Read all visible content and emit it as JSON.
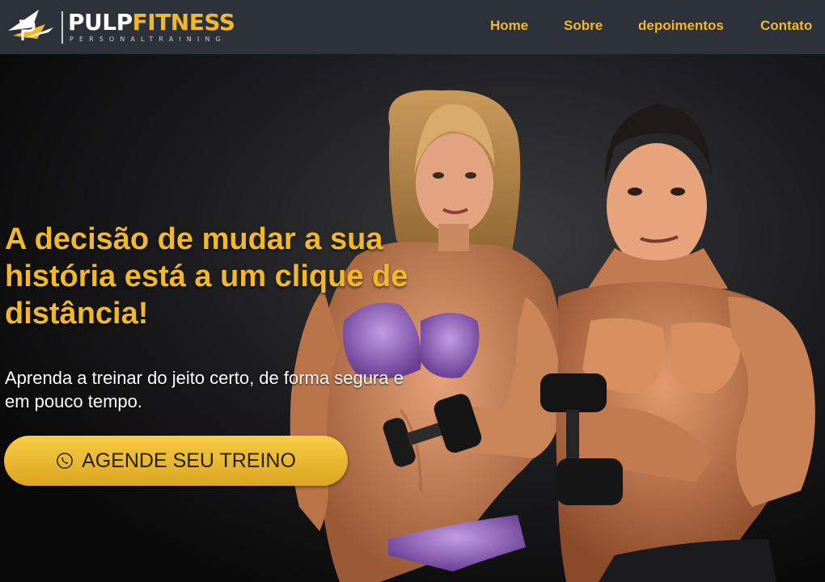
{
  "header": {
    "brand_part1": "PULP",
    "brand_part2": "FITNESS",
    "brand_tagline": "PERSONALTRAINING",
    "logo_icon": "pf-logo-mark"
  },
  "nav": {
    "items": [
      {
        "label": "Home"
      },
      {
        "label": "Sobre"
      },
      {
        "label": "depoimentos"
      },
      {
        "label": "Contato"
      }
    ]
  },
  "hero": {
    "headline": "A decisão de mudar a sua história está a um clique de distância!",
    "subtext": "Aprenda a treinar do jeito certo, de forma segura e em pouco tempo.",
    "cta_label": "AGENDE SEU TREINO",
    "cta_icon": "phone-icon",
    "photo": "fitness-couple-with-dumbbells"
  },
  "colors": {
    "accent": "#f1b82a",
    "header_bg": "#2c313a",
    "hero_bg": "#0b0b0c",
    "cta_gradient_top": "#f8cd45",
    "cta_gradient_bottom": "#dba520"
  }
}
